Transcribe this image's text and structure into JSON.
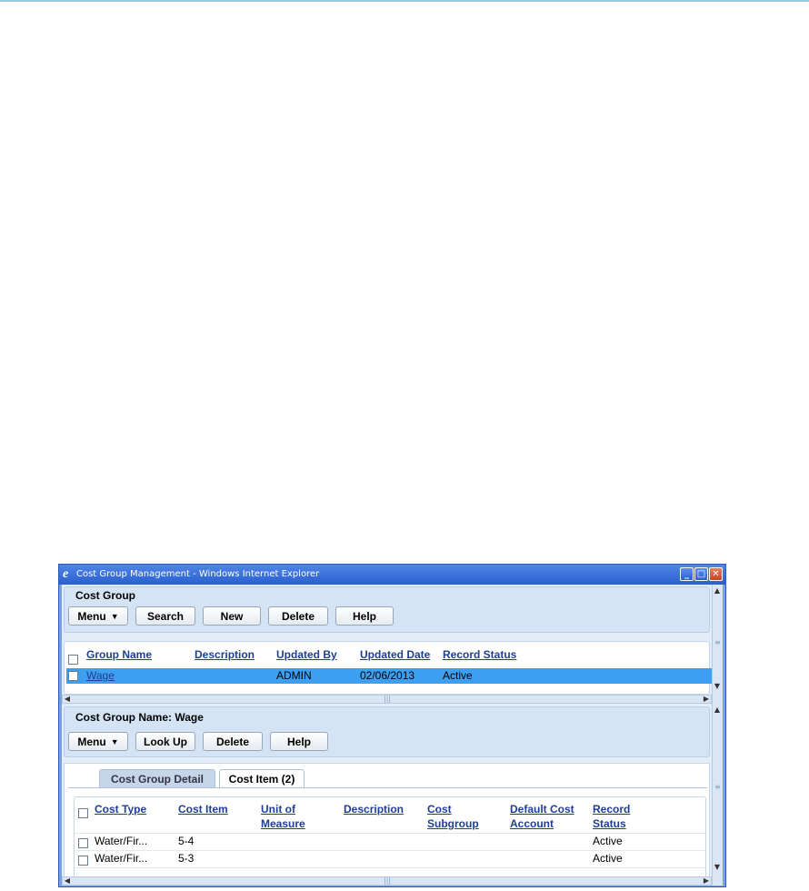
{
  "window": {
    "title": "Cost Group Management - Windows Internet Explorer",
    "icon": "ie-icon",
    "controls": {
      "minimize": "_",
      "maximize": "□",
      "close": "✕"
    }
  },
  "cost_group": {
    "header": "Cost Group",
    "toolbar": {
      "menu": "Menu",
      "search": "Search",
      "new": "New",
      "delete": "Delete",
      "help": "Help"
    },
    "columns": [
      "Group Name",
      "Description",
      "Updated By",
      "Updated Date",
      "Record Status"
    ],
    "rows": [
      {
        "group_name": "Wage",
        "description": "",
        "updated_by": "ADMIN",
        "updated_date": "02/06/2013",
        "record_status": "Active"
      }
    ]
  },
  "detail": {
    "header": "Cost Group Name: Wage",
    "toolbar": {
      "menu": "Menu",
      "lookup": "Look Up",
      "delete": "Delete",
      "help": "Help"
    },
    "tabs": [
      {
        "label": "Cost Group Detail",
        "active": false
      },
      {
        "label": "Cost Item (2)",
        "active": true
      }
    ],
    "columns": [
      {
        "line1": "Cost Type",
        "line2": ""
      },
      {
        "line1": "Cost Item",
        "line2": ""
      },
      {
        "line1": "Unit of",
        "line2": "Measure"
      },
      {
        "line1": "Description",
        "line2": ""
      },
      {
        "line1": "Cost",
        "line2": "Subgroup"
      },
      {
        "line1": "Default Cost",
        "line2": "Account"
      },
      {
        "line1": "Record",
        "line2": "Status"
      }
    ],
    "rows": [
      {
        "cost_type": "Water/Fir...",
        "cost_item": "5-4",
        "unit": "",
        "description": "",
        "subgroup": "",
        "account": "",
        "status": "Active"
      },
      {
        "cost_type": "Water/Fir...",
        "cost_item": "5-3",
        "unit": "",
        "description": "",
        "subgroup": "",
        "account": "",
        "status": "Active"
      }
    ]
  },
  "colors": {
    "selection": "#3c9ff0",
    "link": "#1f3f90",
    "panel": "#d5e4f5",
    "titlebar": "#2a5fd0"
  }
}
